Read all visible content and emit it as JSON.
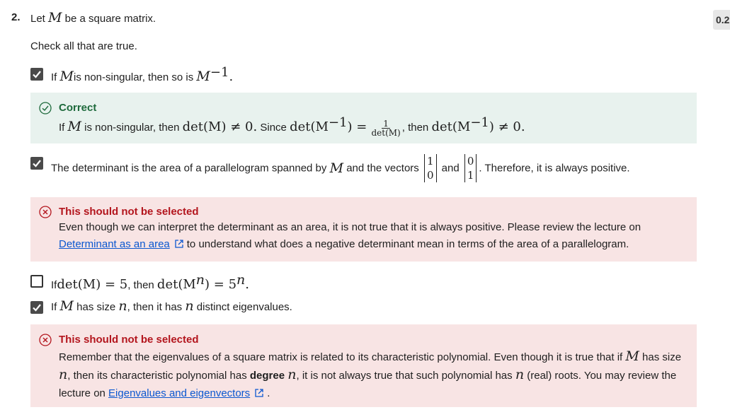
{
  "question": {
    "number": "2.",
    "prompt_prefix": "Let",
    "prompt_var": "M",
    "prompt_suffix": "be a square matrix.",
    "points": "0.2",
    "instruction": "Check all that are true."
  },
  "options": [
    {
      "checked": true,
      "parts": {
        "a": "If",
        "b": "M",
        "c": "is non-singular, then so is",
        "d": "M",
        "e": "−1",
        "f": "."
      }
    },
    {
      "checked": true,
      "parts": {
        "a": "The determinant is the area of a parallelogram spanned by",
        "b": "M",
        "c": "and the vectors",
        "v1a": "1",
        "v1b": "0",
        "and": "and",
        "v2a": "0",
        "v2b": "1",
        "f": ". Therefore, it is always positive."
      }
    },
    {
      "checked": false,
      "parts": {
        "a": "If",
        "b": "det(M) = 5",
        "c": ", then",
        "d": "det(M",
        "e": "n",
        "f": ") = 5",
        "g": "n",
        "h": "."
      }
    },
    {
      "checked": true,
      "parts": {
        "a": "If",
        "b": "M",
        "c": "has size",
        "d": "n",
        "e": ", then it has",
        "f": "n",
        "g": "distinct eigenvalues."
      }
    }
  ],
  "feedback": [
    {
      "status": "correct",
      "heading": "Correct",
      "line": {
        "a": "If",
        "b": "M",
        "c": "is non-singular, then",
        "d": "det(M) ≠ 0.",
        "e": "Since",
        "f": "det(M",
        "g": "−1",
        "h": ") =",
        "num": "1",
        "den": "det(M)",
        "i": ", then",
        "j": "det(M",
        "k": "−1",
        "l": ") ≠ 0."
      }
    },
    {
      "status": "incorrect",
      "heading": "This should not be selected",
      "text1": "Even though we can interpret the determinant as an area, it is not true that it is always positive. Please review the lecture on",
      "link": "Determinant as an area",
      "text2": "to understand what does a negative determinant mean in terms of the area of a parallelogram."
    },
    {
      "status": "incorrect",
      "heading": "This should not be selected",
      "t1": "Remember that the eigenvalues of a square matrix is related to its characteristic polynomial. Even though it is true that if",
      "v1": "M",
      "t2": "has size",
      "v2": "n",
      "t3": ", then its characteristic polynomial has",
      "bold": "degree",
      "v3": "n",
      "t4": ", it is not always true that such polynomial has",
      "v4": "n",
      "t5": "(real) roots. You may review the lecture on",
      "link": "Eigenvalues and eigenvectors",
      "t6": "."
    }
  ],
  "colors": {
    "correct_bg": "#e8f2ee",
    "correct_text": "#1e6a3c",
    "incorrect_bg": "#f8e4e4",
    "incorrect_text": "#b3151d",
    "link": "#0b57d0",
    "checkbox": "#4a4a4a"
  },
  "icons": [
    "check-icon",
    "check-circle-icon",
    "x-circle-icon",
    "external-link-icon"
  ]
}
